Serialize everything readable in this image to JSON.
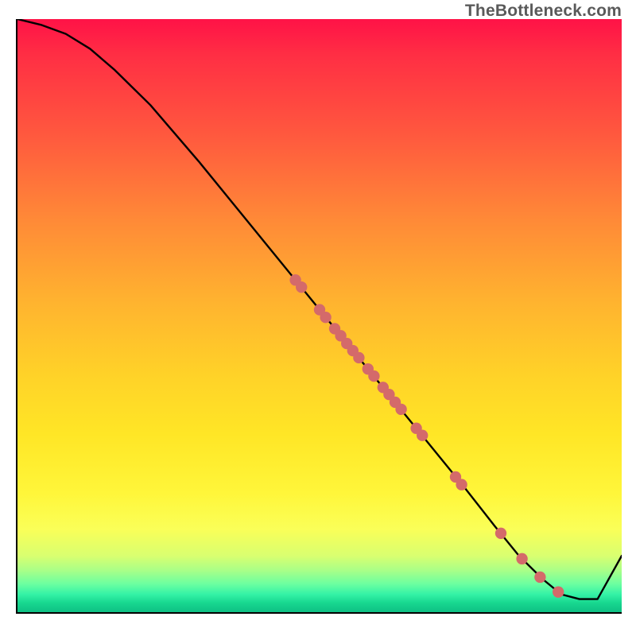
{
  "watermark": "TheBottleneck.com",
  "chart_data": {
    "type": "line",
    "title": "",
    "xlabel": "",
    "ylabel": "",
    "xlim": [
      0,
      100
    ],
    "ylim": [
      0,
      100
    ],
    "grid": false,
    "legend": false,
    "series": [
      {
        "name": "curve",
        "type": "line",
        "color": "#000000",
        "x": [
          0,
          4,
          8,
          12,
          16,
          22,
          30,
          38,
          46,
          54,
          62,
          68,
          74,
          79,
          83,
          87,
          90,
          93,
          96,
          100
        ],
        "y": [
          100,
          99,
          97.5,
          95,
          91.5,
          85.5,
          76,
          66,
          56,
          46,
          36,
          28.5,
          21,
          14.5,
          9.5,
          5.5,
          3,
          2.2,
          2.2,
          9.5
        ]
      },
      {
        "name": "points",
        "type": "scatter",
        "color": "#d46a6a",
        "x": [
          46,
          47,
          50,
          51,
          52.5,
          53.5,
          54.5,
          55.5,
          56.5,
          58,
          59,
          60.5,
          61.5,
          62.5,
          63.5,
          66,
          67,
          72.5,
          73.5,
          80,
          83.5,
          86.5,
          89.5
        ],
        "y": [
          56,
          54.8,
          51,
          49.7,
          47.8,
          46.6,
          45.3,
          44.1,
          42.9,
          41,
          39.8,
          37.9,
          36.7,
          35.4,
          34.2,
          31,
          29.8,
          22.8,
          21.5,
          13.3,
          9,
          5.9,
          3.4
        ]
      }
    ]
  }
}
